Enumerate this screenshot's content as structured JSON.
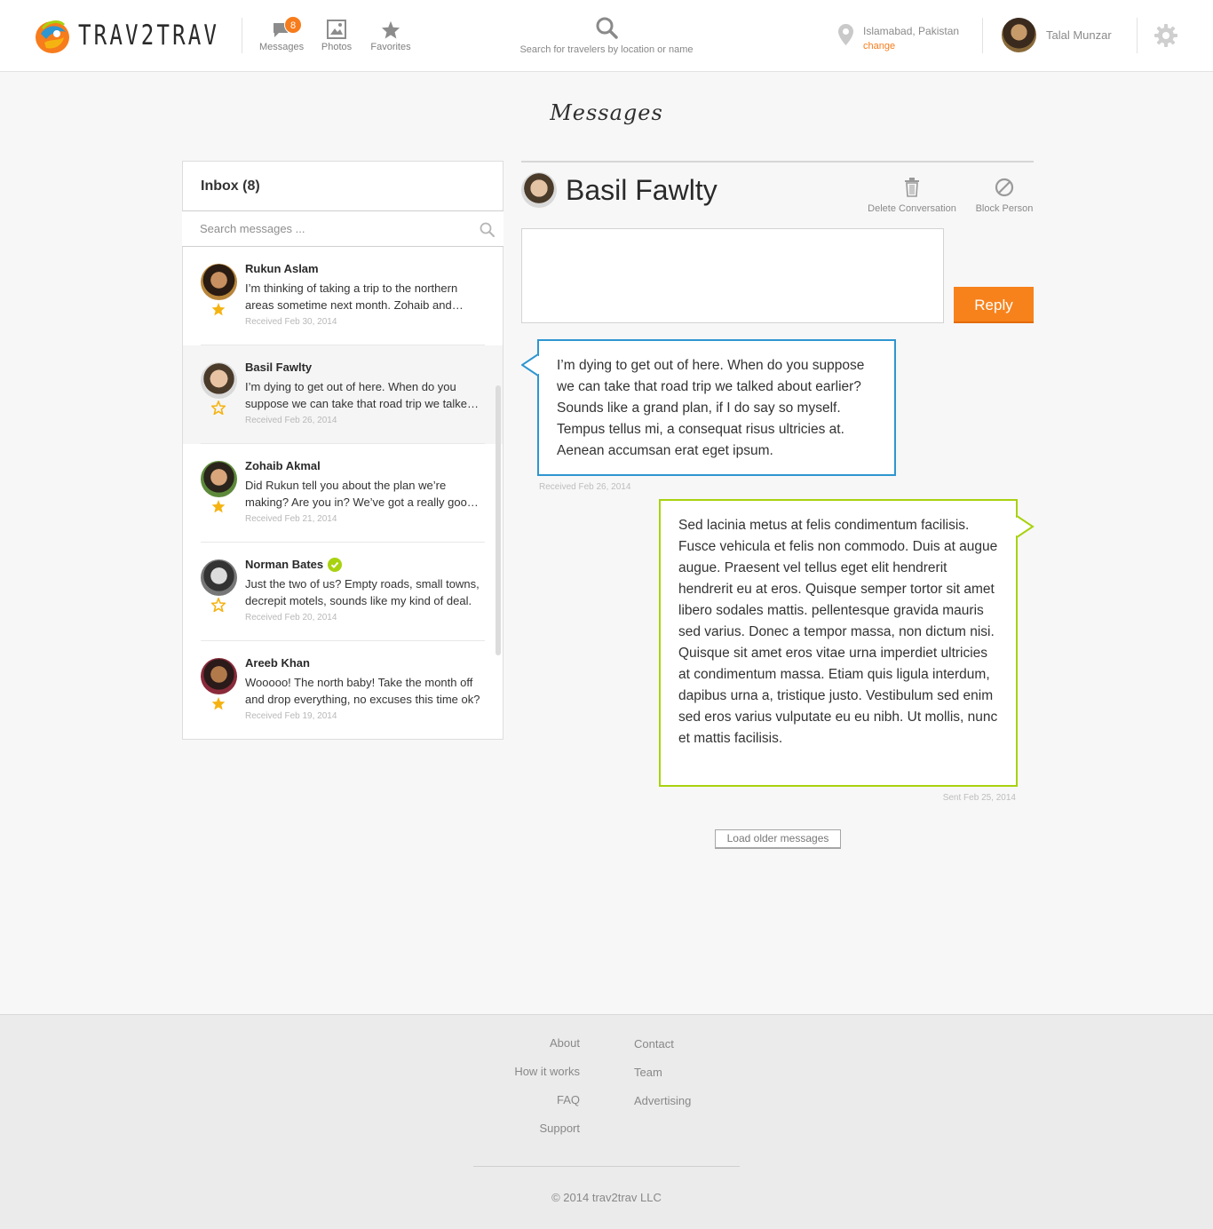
{
  "brand": {
    "name": "TRAV2TRAV"
  },
  "nav": {
    "messages": {
      "label": "Messages",
      "badge": "8"
    },
    "photos": {
      "label": "Photos"
    },
    "favorites": {
      "label": "Favorites"
    }
  },
  "search": {
    "label": "Search for travelers by location or name"
  },
  "location": {
    "city": "Islamabad, Pakistan",
    "change": "change"
  },
  "user": {
    "name": "Talal Munzar"
  },
  "page": {
    "title": "Messages"
  },
  "inbox": {
    "title": "Inbox (8)",
    "search_placeholder": "Search messages ...",
    "items": [
      {
        "sender": "Rukun Aslam",
        "snippet": "I’m thinking of taking a trip to the northern areas sometime next month. Zohaib and Areeb said they might come along too.",
        "date": "Received Feb 30, 2014",
        "starred": true,
        "verified": false,
        "active": false
      },
      {
        "sender": "Basil Fawlty",
        "snippet": "I’m dying to get out of here. When do you suppose we can take that road trip we talked about earlier?",
        "date": "Received Feb 26, 2014",
        "starred": false,
        "verified": false,
        "active": true
      },
      {
        "sender": "Zohaib Akmal",
        "snippet": "Did Rukun tell you about the plan we’re making? Are you in? We’ve got a really good route planned.",
        "date": "Received Feb 21, 2014",
        "starred": true,
        "verified": false,
        "active": false
      },
      {
        "sender": "Norman Bates",
        "snippet": "Just the two of us? Empty roads, small towns, decrepit motels, sounds like my kind of deal.",
        "date": "Received Feb 20, 2014",
        "starred": false,
        "verified": true,
        "active": false
      },
      {
        "sender": "Areeb Khan",
        "snippet": "Wooooo! The north baby! Take the month off and drop everything, no excuses this time ok?",
        "date": "Received Feb 19, 2014",
        "starred": true,
        "verified": false,
        "active": false
      }
    ]
  },
  "conversation": {
    "name": "Basil Fawlty",
    "delete_label": "Delete Conversation",
    "block_label": "Block Person",
    "reply_label": "Reply",
    "received": {
      "text": "I’m dying to get out of here. When do you suppose we can take that road trip we talked about earlier? Sounds like a grand plan, if I do say so myself. Tempus tellus mi, a consequat risus ultricies at. Aenean accumsan erat eget ipsum.",
      "date": "Received Feb 26, 2014"
    },
    "sent": {
      "text": "Sed lacinia metus at felis condimentum facilisis. Fusce vehicula et felis non commodo. Duis at augue augue. Praesent vel tellus eget elit hendrerit hendrerit eu at eros. Quisque semper tortor sit amet libero sodales mattis. pellentesque gravida mauris sed varius. Donec a tempor massa, non dictum nisi. Quisque sit amet eros vitae urna imperdiet ultricies at condimentum massa. Etiam quis ligula interdum, dapibus urna a, tristique justo. Vestibulum sed enim sed eros varius vulputate eu eu nibh. Ut mollis, nunc et mattis facilisis.",
      "date": "Sent Feb 25, 2014"
    },
    "load_older": "Load older messages"
  },
  "footer": {
    "left": [
      "About",
      "How it works",
      "FAQ",
      "Support"
    ],
    "right": [
      "Contact",
      "Team",
      "Advertising"
    ],
    "copyright": "© 2014 trav2trav LLC"
  },
  "colors": {
    "accent": "#f7821c",
    "received_border": "#2e96d0",
    "sent_border": "#a8d20f",
    "star": "#f5b312",
    "verified": "#a8d20f"
  }
}
